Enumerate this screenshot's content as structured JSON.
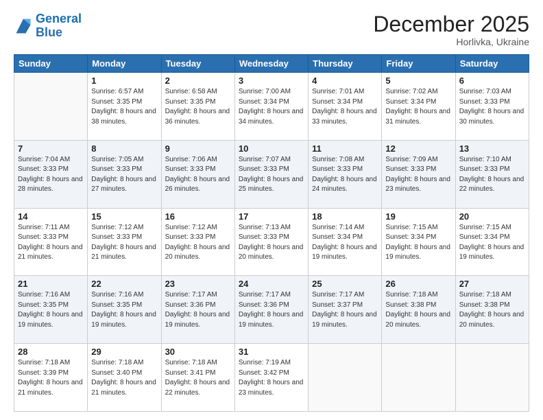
{
  "logo": {
    "line1": "General",
    "line2": "Blue"
  },
  "header": {
    "month": "December 2025",
    "location": "Horlivka, Ukraine"
  },
  "weekdays": [
    "Sunday",
    "Monday",
    "Tuesday",
    "Wednesday",
    "Thursday",
    "Friday",
    "Saturday"
  ],
  "weeks": [
    [
      {
        "day": "",
        "sunrise": "",
        "sunset": "",
        "daylight": ""
      },
      {
        "day": "1",
        "sunrise": "Sunrise: 6:57 AM",
        "sunset": "Sunset: 3:35 PM",
        "daylight": "Daylight: 8 hours and 38 minutes."
      },
      {
        "day": "2",
        "sunrise": "Sunrise: 6:58 AM",
        "sunset": "Sunset: 3:35 PM",
        "daylight": "Daylight: 8 hours and 36 minutes."
      },
      {
        "day": "3",
        "sunrise": "Sunrise: 7:00 AM",
        "sunset": "Sunset: 3:34 PM",
        "daylight": "Daylight: 8 hours and 34 minutes."
      },
      {
        "day": "4",
        "sunrise": "Sunrise: 7:01 AM",
        "sunset": "Sunset: 3:34 PM",
        "daylight": "Daylight: 8 hours and 33 minutes."
      },
      {
        "day": "5",
        "sunrise": "Sunrise: 7:02 AM",
        "sunset": "Sunset: 3:34 PM",
        "daylight": "Daylight: 8 hours and 31 minutes."
      },
      {
        "day": "6",
        "sunrise": "Sunrise: 7:03 AM",
        "sunset": "Sunset: 3:33 PM",
        "daylight": "Daylight: 8 hours and 30 minutes."
      }
    ],
    [
      {
        "day": "7",
        "sunrise": "Sunrise: 7:04 AM",
        "sunset": "Sunset: 3:33 PM",
        "daylight": "Daylight: 8 hours and 28 minutes."
      },
      {
        "day": "8",
        "sunrise": "Sunrise: 7:05 AM",
        "sunset": "Sunset: 3:33 PM",
        "daylight": "Daylight: 8 hours and 27 minutes."
      },
      {
        "day": "9",
        "sunrise": "Sunrise: 7:06 AM",
        "sunset": "Sunset: 3:33 PM",
        "daylight": "Daylight: 8 hours and 26 minutes."
      },
      {
        "day": "10",
        "sunrise": "Sunrise: 7:07 AM",
        "sunset": "Sunset: 3:33 PM",
        "daylight": "Daylight: 8 hours and 25 minutes."
      },
      {
        "day": "11",
        "sunrise": "Sunrise: 7:08 AM",
        "sunset": "Sunset: 3:33 PM",
        "daylight": "Daylight: 8 hours and 24 minutes."
      },
      {
        "day": "12",
        "sunrise": "Sunrise: 7:09 AM",
        "sunset": "Sunset: 3:33 PM",
        "daylight": "Daylight: 8 hours and 23 minutes."
      },
      {
        "day": "13",
        "sunrise": "Sunrise: 7:10 AM",
        "sunset": "Sunset: 3:33 PM",
        "daylight": "Daylight: 8 hours and 22 minutes."
      }
    ],
    [
      {
        "day": "14",
        "sunrise": "Sunrise: 7:11 AM",
        "sunset": "Sunset: 3:33 PM",
        "daylight": "Daylight: 8 hours and 21 minutes."
      },
      {
        "day": "15",
        "sunrise": "Sunrise: 7:12 AM",
        "sunset": "Sunset: 3:33 PM",
        "daylight": "Daylight: 8 hours and 21 minutes."
      },
      {
        "day": "16",
        "sunrise": "Sunrise: 7:12 AM",
        "sunset": "Sunset: 3:33 PM",
        "daylight": "Daylight: 8 hours and 20 minutes."
      },
      {
        "day": "17",
        "sunrise": "Sunrise: 7:13 AM",
        "sunset": "Sunset: 3:33 PM",
        "daylight": "Daylight: 8 hours and 20 minutes."
      },
      {
        "day": "18",
        "sunrise": "Sunrise: 7:14 AM",
        "sunset": "Sunset: 3:34 PM",
        "daylight": "Daylight: 8 hours and 19 minutes."
      },
      {
        "day": "19",
        "sunrise": "Sunrise: 7:15 AM",
        "sunset": "Sunset: 3:34 PM",
        "daylight": "Daylight: 8 hours and 19 minutes."
      },
      {
        "day": "20",
        "sunrise": "Sunrise: 7:15 AM",
        "sunset": "Sunset: 3:34 PM",
        "daylight": "Daylight: 8 hours and 19 minutes."
      }
    ],
    [
      {
        "day": "21",
        "sunrise": "Sunrise: 7:16 AM",
        "sunset": "Sunset: 3:35 PM",
        "daylight": "Daylight: 8 hours and 19 minutes."
      },
      {
        "day": "22",
        "sunrise": "Sunrise: 7:16 AM",
        "sunset": "Sunset: 3:35 PM",
        "daylight": "Daylight: 8 hours and 19 minutes."
      },
      {
        "day": "23",
        "sunrise": "Sunrise: 7:17 AM",
        "sunset": "Sunset: 3:36 PM",
        "daylight": "Daylight: 8 hours and 19 minutes."
      },
      {
        "day": "24",
        "sunrise": "Sunrise: 7:17 AM",
        "sunset": "Sunset: 3:36 PM",
        "daylight": "Daylight: 8 hours and 19 minutes."
      },
      {
        "day": "25",
        "sunrise": "Sunrise: 7:17 AM",
        "sunset": "Sunset: 3:37 PM",
        "daylight": "Daylight: 8 hours and 19 minutes."
      },
      {
        "day": "26",
        "sunrise": "Sunrise: 7:18 AM",
        "sunset": "Sunset: 3:38 PM",
        "daylight": "Daylight: 8 hours and 20 minutes."
      },
      {
        "day": "27",
        "sunrise": "Sunrise: 7:18 AM",
        "sunset": "Sunset: 3:38 PM",
        "daylight": "Daylight: 8 hours and 20 minutes."
      }
    ],
    [
      {
        "day": "28",
        "sunrise": "Sunrise: 7:18 AM",
        "sunset": "Sunset: 3:39 PM",
        "daylight": "Daylight: 8 hours and 21 minutes."
      },
      {
        "day": "29",
        "sunrise": "Sunrise: 7:18 AM",
        "sunset": "Sunset: 3:40 PM",
        "daylight": "Daylight: 8 hours and 21 minutes."
      },
      {
        "day": "30",
        "sunrise": "Sunrise: 7:18 AM",
        "sunset": "Sunset: 3:41 PM",
        "daylight": "Daylight: 8 hours and 22 minutes."
      },
      {
        "day": "31",
        "sunrise": "Sunrise: 7:19 AM",
        "sunset": "Sunset: 3:42 PM",
        "daylight": "Daylight: 8 hours and 23 minutes."
      },
      {
        "day": "",
        "sunrise": "",
        "sunset": "",
        "daylight": ""
      },
      {
        "day": "",
        "sunrise": "",
        "sunset": "",
        "daylight": ""
      },
      {
        "day": "",
        "sunrise": "",
        "sunset": "",
        "daylight": ""
      }
    ]
  ]
}
